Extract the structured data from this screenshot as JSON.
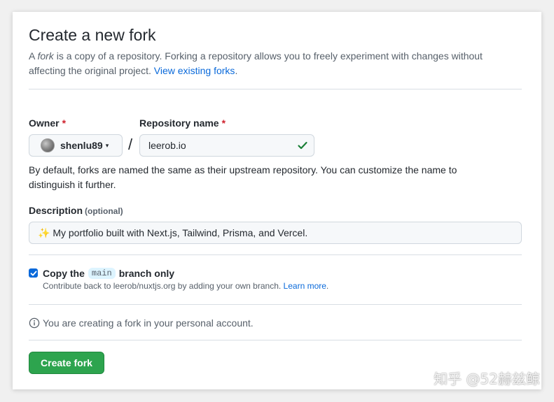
{
  "page": {
    "title": "Create a new fork",
    "intro_prefix": "A ",
    "intro_em": "fork",
    "intro_text": " is a copy of a repository. Forking a repository allows you to freely experiment with changes without affecting the original project. ",
    "intro_link": "View existing forks",
    "intro_suffix": "."
  },
  "owner": {
    "label": "Owner",
    "required_mark": "*",
    "name": "shenlu89",
    "caret": "▾"
  },
  "separator": "/",
  "repository": {
    "label": "Repository name",
    "required_mark": "*",
    "value": "leerob.io",
    "valid_color": "#1a7f37"
  },
  "hint": "By default, forks are named the same as their upstream repository. You can customize the name to distinguish it further.",
  "description": {
    "label": "Description",
    "optional": "(optional)",
    "value": "✨ My portfolio built with Next.js, Tailwind, Prisma, and Vercel."
  },
  "copy_branch": {
    "checked": true,
    "prefix": "Copy the",
    "branch": "main",
    "suffix": "branch only",
    "note_text": "Contribute back to leerob/nuxtjs.org by adding your own branch. ",
    "note_link": "Learn more",
    "note_suffix": "."
  },
  "info": "You are creating a fork in your personal account.",
  "submit": {
    "label": "Create fork",
    "color": "#2da44e"
  },
  "watermark": "知乎 @52赫兹鲸",
  "colors": {
    "link": "#0969da",
    "required": "#cf222e",
    "text": "#24292f",
    "muted": "#57606a"
  }
}
